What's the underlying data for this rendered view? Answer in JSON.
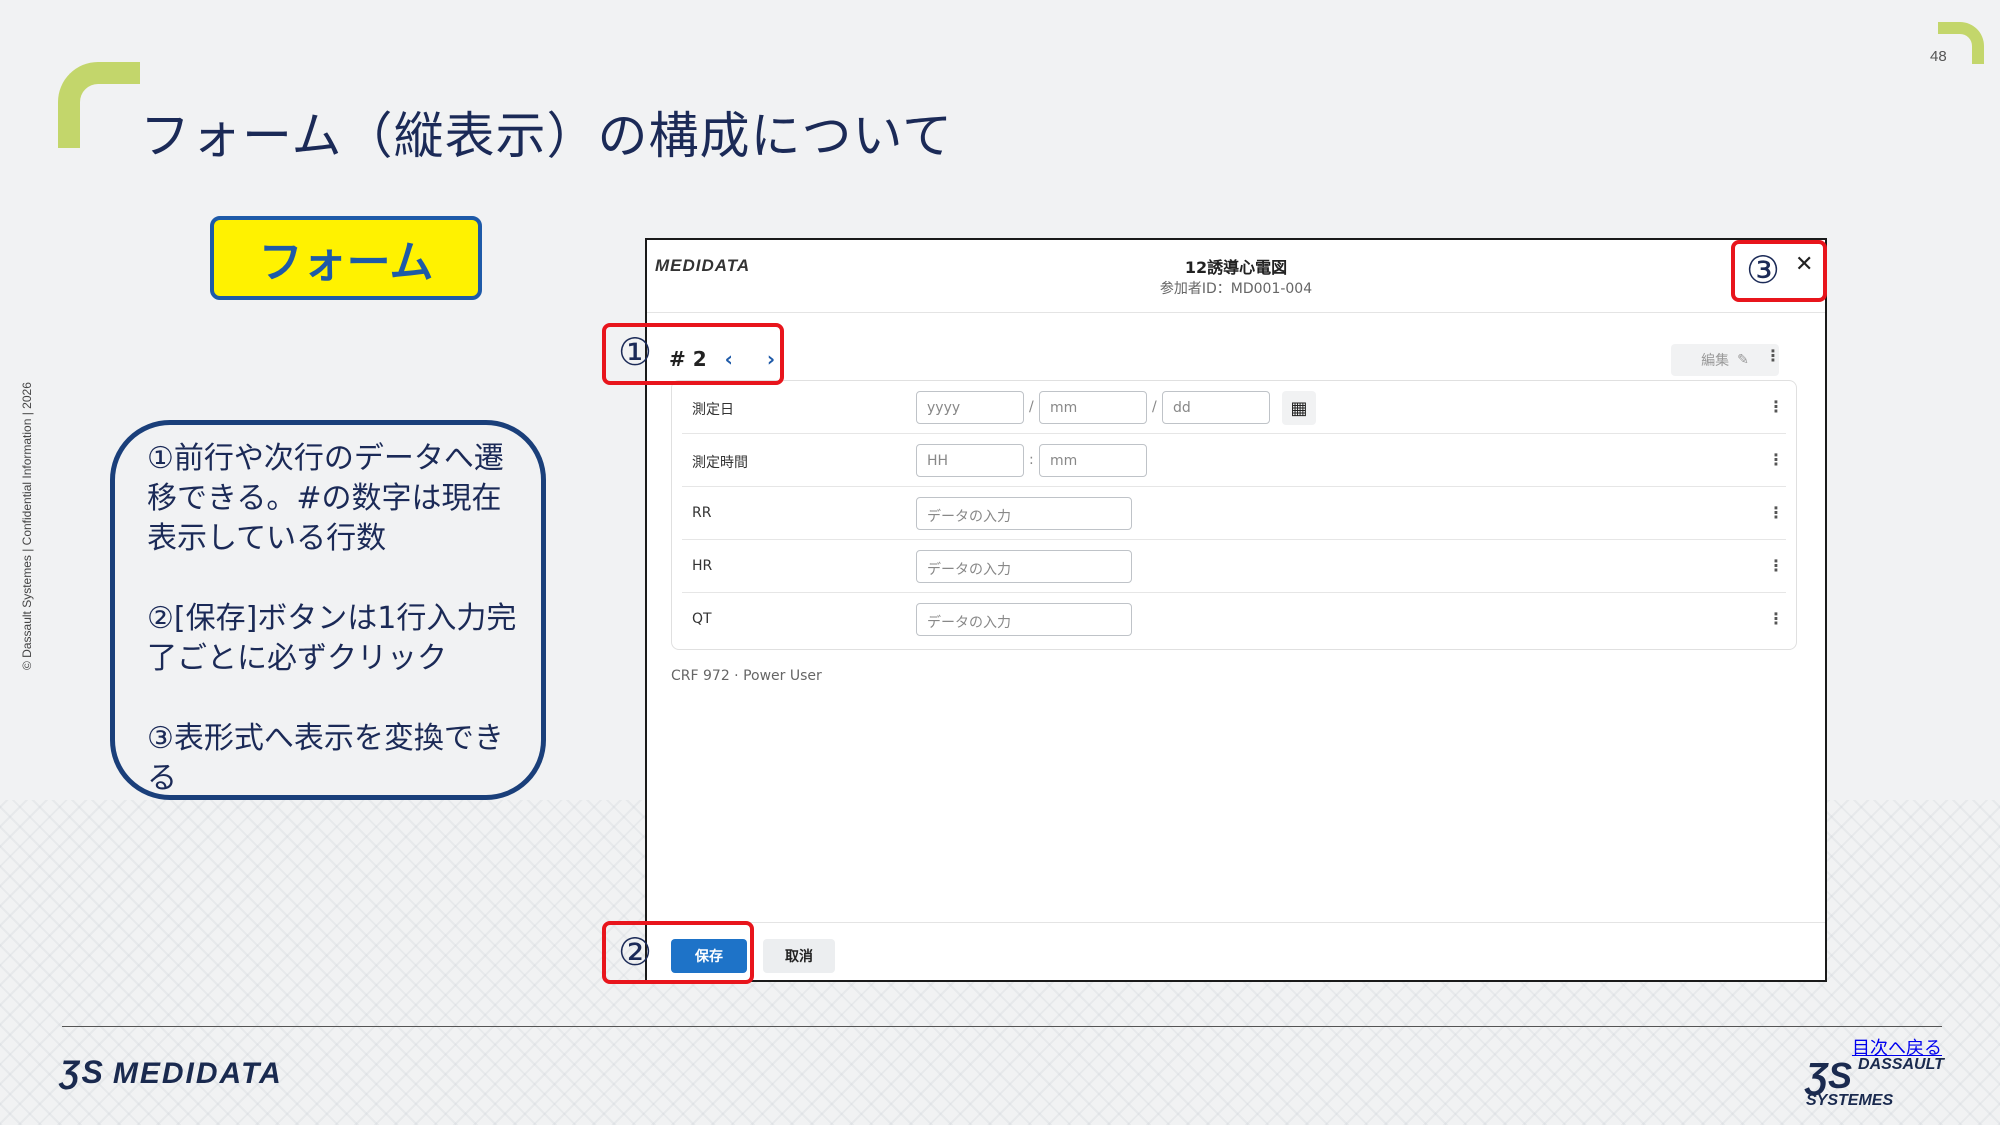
{
  "slide": {
    "title": "フォーム（縦表示）の構成について",
    "page_number": "48",
    "copyright": "© Dassault Systemes | Confidential Information | 2026",
    "form_label": "フォーム",
    "callout": {
      "item1": "①前行や次行のデータへ遷移できる。#の数字は現在表示している行数",
      "item2": "②[保存]ボタンは1行入力完了ごとに必ずクリック",
      "item3": "③表形式へ表示を変換できる"
    },
    "markers": {
      "m1": "①",
      "m2": "②",
      "m3": "③"
    },
    "footer": {
      "toc_link": "目次へ戻る",
      "medidata_logo": "MEDIDATA",
      "dassault_line1": "DASSAULT",
      "dassault_line2": "SYSTEMES"
    },
    "accent_color": "#c3d66b",
    "highlight_color": "#e8151c"
  },
  "dialog": {
    "logo": "MEDIDATA",
    "title": "12誘導心電図",
    "subtitle": "参加者ID：MD001-004",
    "close_icon": "close-icon",
    "row_number": "# 2",
    "prev": "‹",
    "next": "›",
    "edit_label": "編集",
    "fields": [
      {
        "label": "測定日",
        "inputs": [
          "yyyy",
          "mm",
          "dd"
        ]
      },
      {
        "label": "測定時間",
        "inputs": [
          "HH",
          "mm"
        ]
      },
      {
        "label": "RR",
        "placeholder": "データの入力"
      },
      {
        "label": "HR",
        "placeholder": "データの入力"
      },
      {
        "label": "QT",
        "placeholder": "データの入力"
      }
    ],
    "crf_info": "CRF 972 · Power User",
    "save_label": "保存",
    "cancel_label": "取消",
    "primary_color": "#1e73c8"
  }
}
